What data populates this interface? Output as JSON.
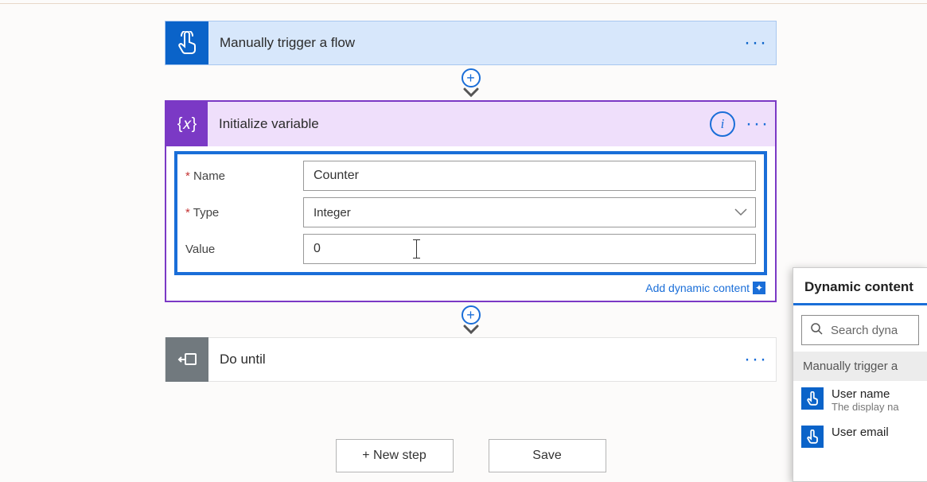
{
  "trigger": {
    "title": "Manually trigger a flow"
  },
  "variable": {
    "title": "Initialize variable",
    "name_label": "Name",
    "name_value": "Counter",
    "type_label": "Type",
    "type_value": "Integer",
    "value_label": "Value",
    "value_value": "0",
    "dynamic_link": "Add dynamic content"
  },
  "do_until": {
    "title": "Do until"
  },
  "buttons": {
    "new_step": "+ New step",
    "save": "Save"
  },
  "dyn_panel": {
    "tab": "Dynamic content",
    "search_placeholder": "Search dyna",
    "section": "Manually trigger a",
    "items": [
      {
        "title": "User name",
        "subtitle": "The display na"
      },
      {
        "title": "User email",
        "subtitle": ""
      }
    ]
  }
}
